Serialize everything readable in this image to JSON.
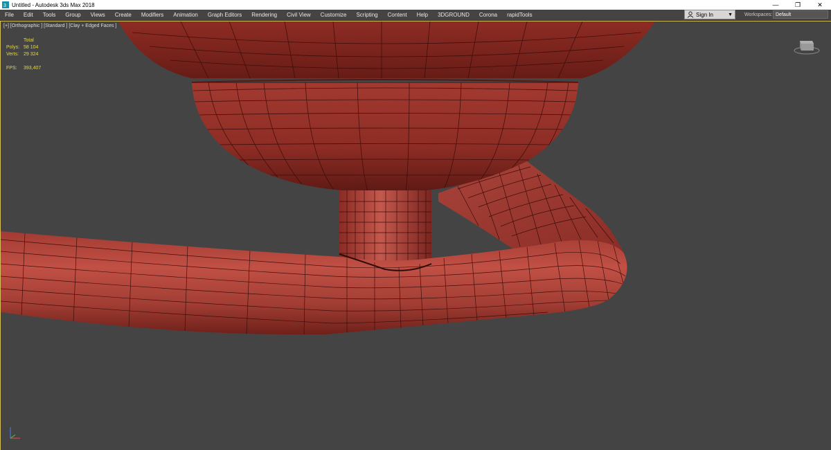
{
  "window": {
    "title": "Untitled - Autodesk 3ds Max 2018",
    "app_icon": "3dsmax-icon",
    "controls": {
      "minimize": "—",
      "restore": "❐",
      "close": "✕"
    }
  },
  "menu": [
    "File",
    "Edit",
    "Tools",
    "Group",
    "Views",
    "Create",
    "Modifiers",
    "Animation",
    "Graph Editors",
    "Rendering",
    "Civil View",
    "Customize",
    "Scripting",
    "Content",
    "Help",
    "3DGROUND",
    "Corona",
    "rapidTools"
  ],
  "account": {
    "signin_label": "Sign In",
    "icon": "user-icon"
  },
  "workspaces": {
    "label": "Workspaces:",
    "value": "Default"
  },
  "viewport": {
    "label": "[+] [Orthographic ] [Standard ] [Clay + Edged Faces ]",
    "stats": {
      "header": "Total",
      "polys_label": "Polys:",
      "polys_value": "58 104",
      "verts_label": "Verts:",
      "verts_value": "29 324",
      "fps_label": "FPS:",
      "fps_value": "393,407"
    },
    "viewcube_icon": "viewcube-icon",
    "axis_icon": "axis-tripod-icon"
  },
  "colors": {
    "viewport_bg": "#444444",
    "mesh_red": "#b2463b",
    "mesh_dark": "#6e1f1a",
    "wire": "#3a0c09",
    "stats_yellow": "#e3d84a",
    "active_border": "#d8c060"
  }
}
